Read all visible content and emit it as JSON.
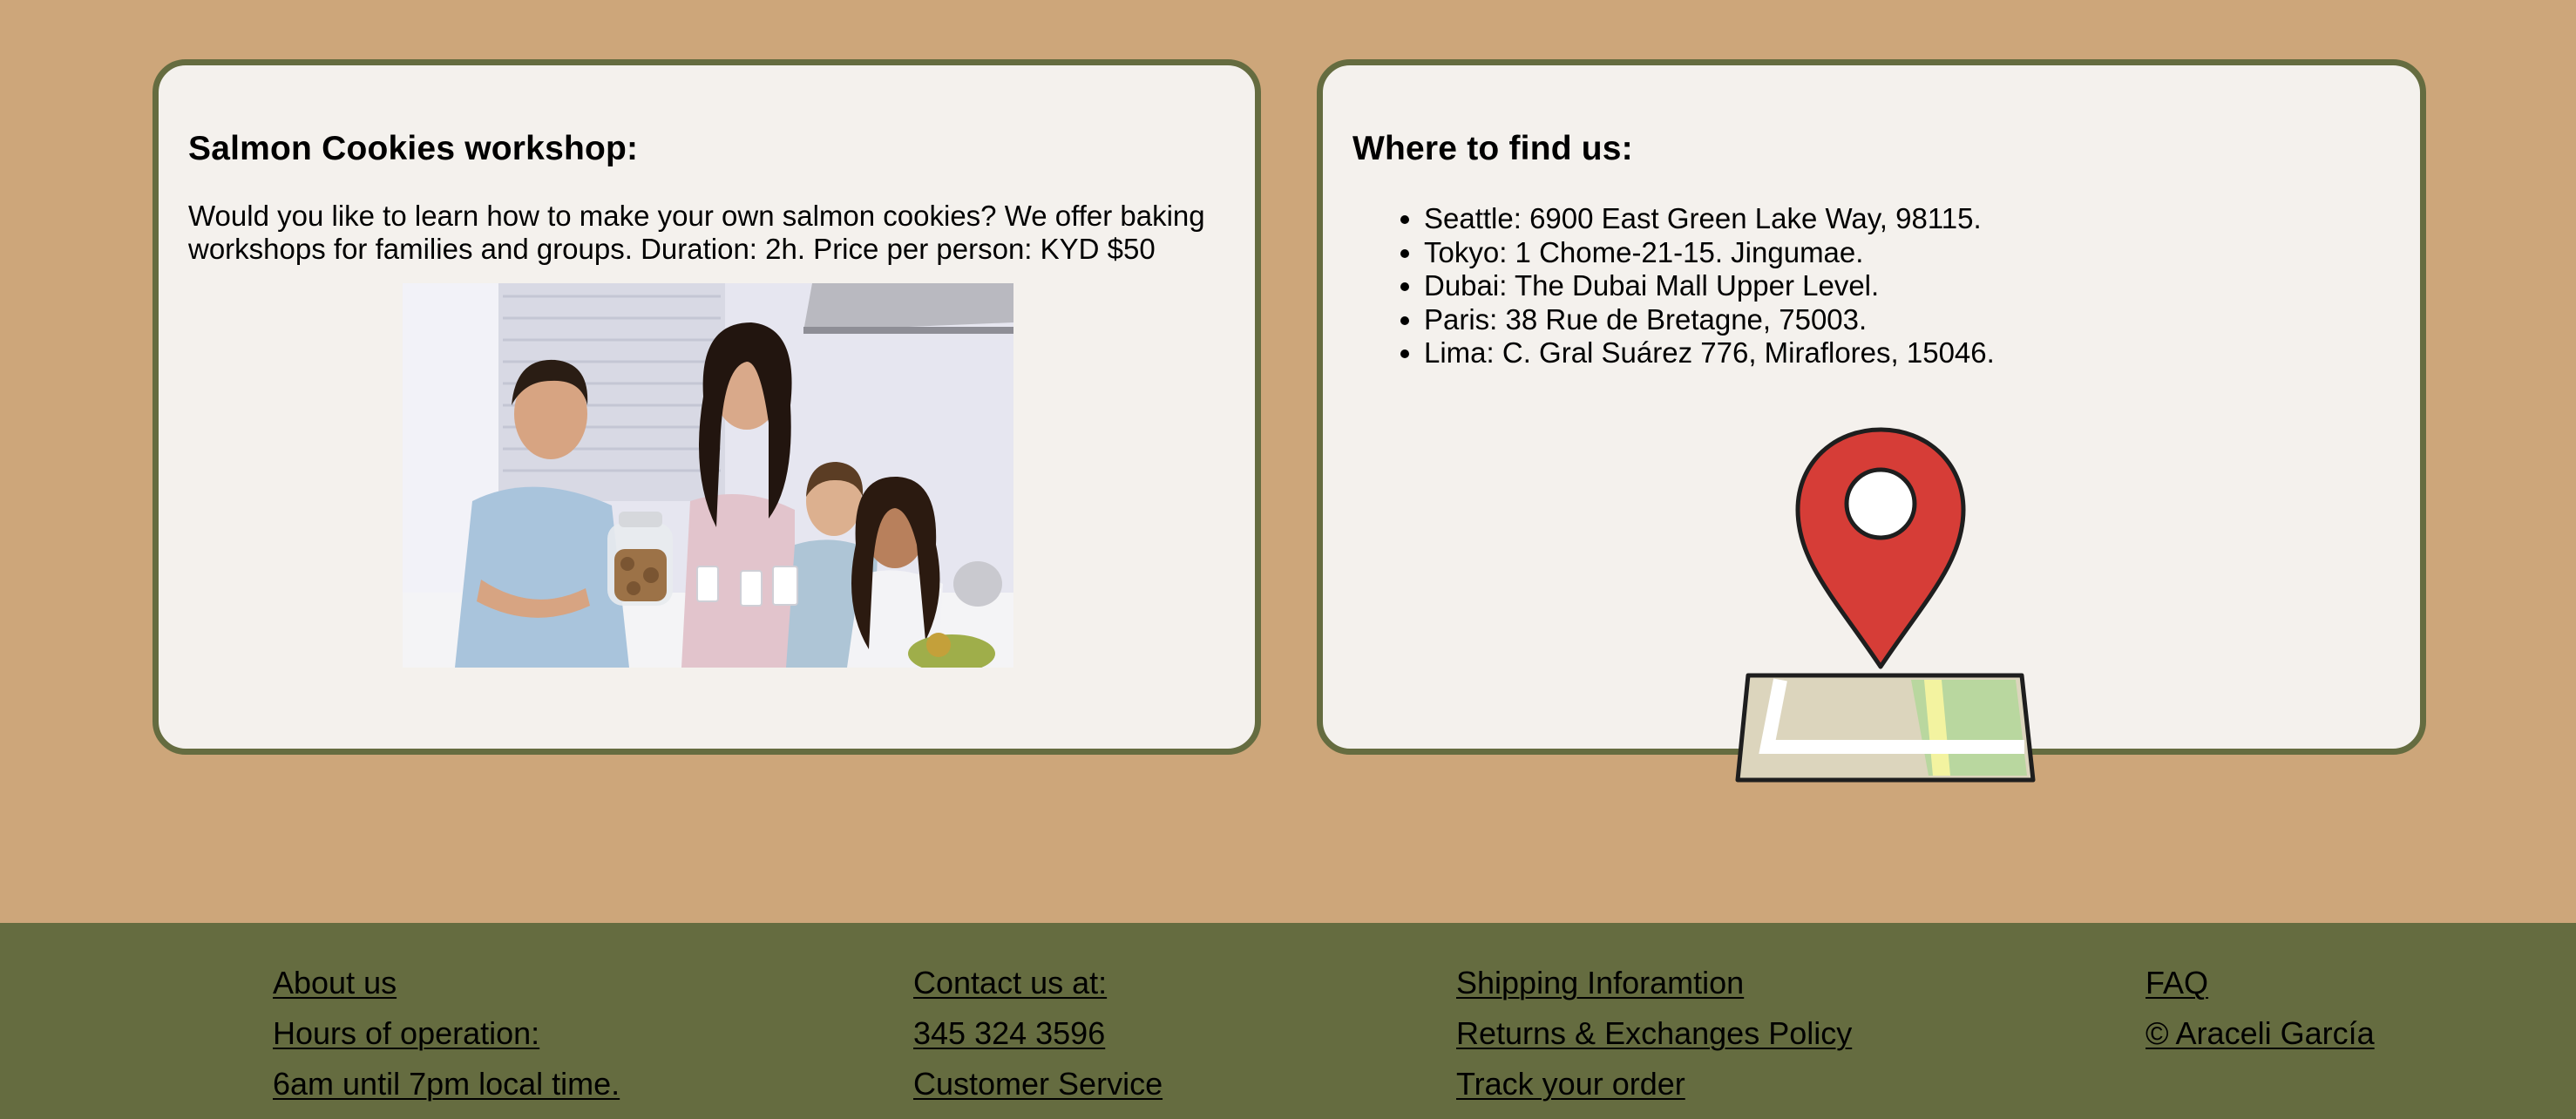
{
  "workshop": {
    "title": "Salmon Cookies workshop:",
    "description": "Would you like to learn how to make your own salmon cookies? We offer baking workshops for families and groups. Duration: 2h. Price per person: KYD $50",
    "image_alt": "Family with cookie jar in kitchen"
  },
  "locations": {
    "title": "Where to find us:",
    "items": [
      "Seattle: 6900 East Green Lake Way, 98115.",
      "Tokyo: 1 Chome-21-15. Jingumae.",
      "Dubai: The Dubai Mall Upper Level.",
      "Paris: 38 Rue de Bretagne, 75003.",
      "Lima: C. Gral Suárez 776, Miraflores, 15046."
    ],
    "icon": "map-pin-icon"
  },
  "footer": {
    "col1": [
      "About us",
      "Hours of operation:",
      "6am until 7pm local time."
    ],
    "col2": [
      "Contact us at:",
      "345 324 3596",
      "Customer Service"
    ],
    "col3": [
      "Shipping Inforamtion",
      "Returns & Exchanges Policy",
      "Track your order"
    ],
    "col4": [
      "FAQ",
      "© Araceli García"
    ]
  },
  "colors": {
    "background": "#cda67a",
    "card": "#f4f1ed",
    "accent": "#656c40",
    "pin": "#d63d37"
  }
}
